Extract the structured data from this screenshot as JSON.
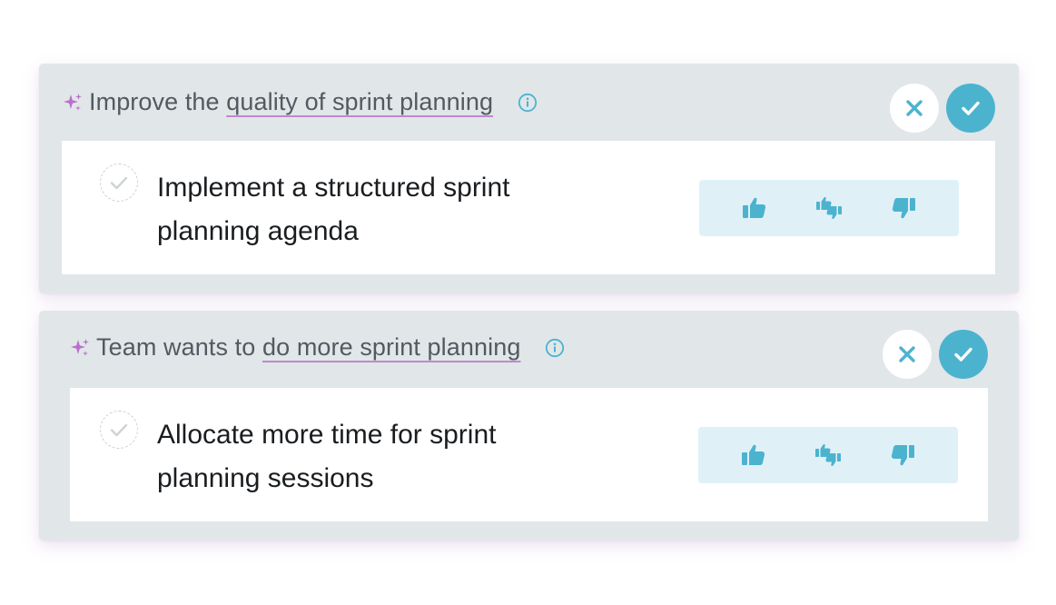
{
  "suggestions": [
    {
      "goal_prefix": "Improve the ",
      "goal_highlight": "quality of sprint planning",
      "action_line1": "Implement a structured sprint",
      "action_line2": "planning agenda"
    },
    {
      "goal_prefix": "Team wants to ",
      "goal_highlight": "do more sprint planning",
      "action_line1": "Allocate more time for sprint",
      "action_line2": "planning sessions"
    }
  ],
  "colors": {
    "card_background": "#e1e6e9",
    "accent": "#4cb3cf",
    "sparkle": "#b86fcb",
    "highlight_underline": "#c088cf",
    "feedback_background": "#dff1f7"
  },
  "icons": {
    "goal": "sparkle-icon",
    "info": "info-icon",
    "dismiss": "close-icon",
    "accept": "check-icon",
    "complete": "check-circle-icon",
    "feedback": [
      "thumbs-up-icon",
      "thumbs-mixed-icon",
      "thumbs-down-icon"
    ]
  }
}
